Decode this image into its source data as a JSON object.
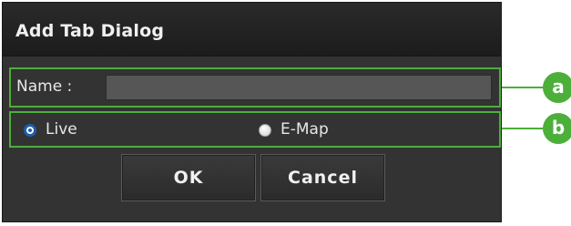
{
  "dialog": {
    "title": "Add Tab Dialog",
    "name_label": "Name :",
    "name_value": "",
    "radio_options": [
      {
        "label": "Live",
        "selected": true
      },
      {
        "label": "E-Map",
        "selected": false
      }
    ],
    "ok_label": "OK",
    "cancel_label": "Cancel"
  },
  "annotations": {
    "a": "a",
    "b": "b",
    "color": "#4caf3a"
  },
  "colors": {
    "dialog_bg": "#333333",
    "titlebar_bg": "#1c1c1c",
    "field_bg": "#565656",
    "radio_selected": "#1d5fa8",
    "highlight": "#4caf3a"
  }
}
